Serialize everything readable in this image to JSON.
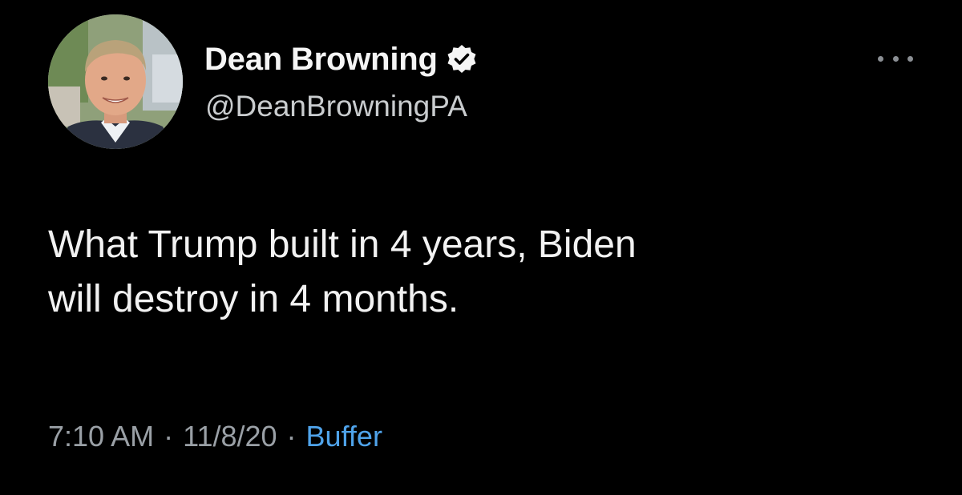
{
  "author": {
    "display_name": "Dean Browning",
    "handle": "@DeanBrowningPA",
    "verified": true,
    "avatar_icon": "profile-photo"
  },
  "tweet": {
    "text": "What Trump built in 4 years, Biden\nwill destroy in 4 months."
  },
  "meta": {
    "time": "7:10 AM",
    "separator": "·",
    "date": "11/8/20",
    "source": "Buffer"
  },
  "more_icon": "ellipsis-icon",
  "colors": {
    "background": "#000000",
    "text": "#f2f2f2",
    "secondary": "#9aa0a6",
    "link": "#4fa3ea"
  }
}
